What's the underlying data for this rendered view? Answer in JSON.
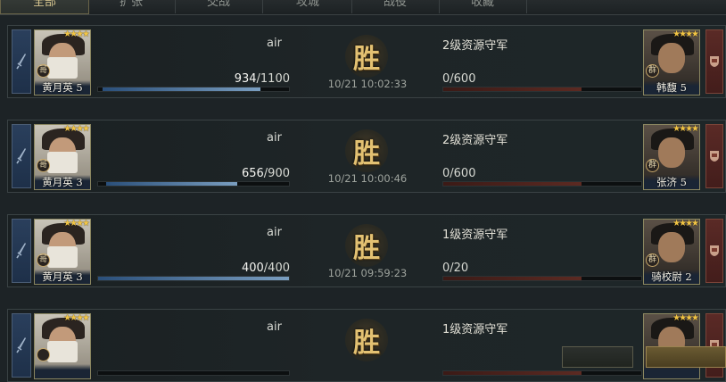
{
  "tabs": [
    "全部",
    "扩张",
    "交战",
    "攻城",
    "战役",
    "收藏"
  ],
  "active_tab": 0,
  "records": [
    {
      "player": "air",
      "self_name": "黄月英",
      "self_level": "5",
      "self_badge": "哥",
      "troops_current": "934",
      "troops_max": "/1100",
      "troops_fraction": 0.8491,
      "result": "胜",
      "time": "10/21 10:02:33",
      "defender": "2级资源守军",
      "defender_troops": "0/600",
      "enemy_name": "韩馥",
      "enemy_level": "5",
      "enemy_badge": "群"
    },
    {
      "player": "air",
      "self_name": "黄月英",
      "self_level": "3",
      "self_badge": "哥",
      "troops_current": "656",
      "troops_max": "/900",
      "troops_fraction": 0.7289,
      "result": "胜",
      "time": "10/21 10:00:46",
      "defender": "2级资源守军",
      "defender_troops": "0/600",
      "enemy_name": "张济",
      "enemy_level": "5",
      "enemy_badge": "群"
    },
    {
      "player": "air",
      "self_name": "黄月英",
      "self_level": "3",
      "self_badge": "哥",
      "troops_current": "400",
      "troops_max": "/400",
      "troops_fraction": 1.0,
      "result": "胜",
      "time": "10/21 09:59:23",
      "defender": "1级资源守军",
      "defender_troops": "0/20",
      "enemy_name": "骑校尉",
      "enemy_level": "2",
      "enemy_badge": "群"
    },
    {
      "player": "air",
      "self_name": "",
      "self_level": "",
      "self_badge": "",
      "troops_current": "",
      "troops_max": "",
      "troops_fraction": 0,
      "result": "胜",
      "time": "",
      "defender": "1级资源守军",
      "defender_troops": "",
      "enemy_name": "",
      "enemy_level": "",
      "enemy_badge": ""
    }
  ],
  "colors": {
    "troop_bar": "#6f93b8",
    "victory_seal": "#e3c172",
    "attacker_strip": "#2a3f5c",
    "defender_strip": "#5a2a26",
    "stars": "#f2c544"
  }
}
